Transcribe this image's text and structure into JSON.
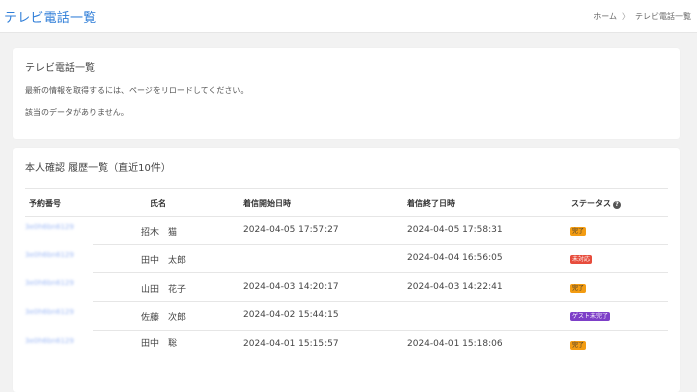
{
  "header": {
    "title": "テレビ電話一覧"
  },
  "breadcrumb": {
    "home": "ホーム",
    "separator": "〉",
    "current": "テレビ電話一覧"
  },
  "calls": {
    "title": "テレビ電話一覧",
    "info": "最新の情報を取得するには、ページをリロードしてください。",
    "empty": "該当のデータがありません。"
  },
  "history": {
    "title": "本人確認 履歴一覧（直近10件）",
    "columns": [
      "予約番号",
      "氏名",
      "着信開始日時",
      "着信終了日時",
      "ステータス"
    ],
    "rows": [
      {
        "reservation": "3e0h6bn6129",
        "name": "招木　猫",
        "start": "2024-04-05 17:57:27",
        "end": "2024-04-05 17:58:31",
        "status": "完了"
      },
      {
        "reservation": "3e0h6bn6129",
        "name": "田中　太郎",
        "start": "",
        "end": "2024-04-04 16:56:05",
        "status": "未対応"
      },
      {
        "reservation": "3e0h6bn6129",
        "name": "山田　花子",
        "start": "2024-04-03 14:20:17",
        "end": "2024-04-03 14:22:41",
        "status": "完了"
      },
      {
        "reservation": "3e0h6bn6129",
        "name": "佐藤　次郎",
        "start": "2024-04-02 15:44:15",
        "end": "",
        "status": "ゲスト未完了"
      },
      {
        "reservation": "3e0h6bn6129",
        "name": "田中　聡",
        "start": "2024-04-01 15:15:57",
        "end": "2024-04-01 15:18:06",
        "status": "完了"
      }
    ]
  },
  "colors": {
    "accent": "#2f7ed8",
    "status_done": "#f39c12",
    "status_pending": "#e74c3c",
    "status_guest": "#7d3fc8"
  },
  "icons": {
    "status_help": "question-circle-icon"
  }
}
